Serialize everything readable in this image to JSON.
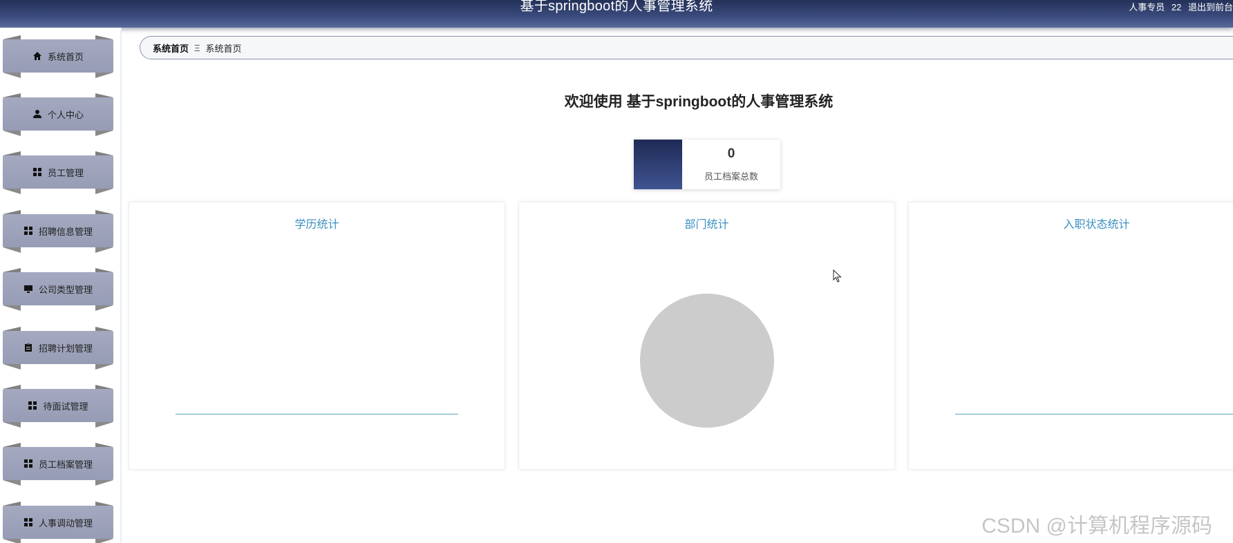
{
  "header": {
    "title": "基于springboot的人事管理系统",
    "user_role": "人事专员",
    "user_name": "22",
    "exit_label": "退出到前台"
  },
  "sidebar": {
    "items": [
      {
        "label": "系统首页",
        "icon": "home-icon"
      },
      {
        "label": "个人中心",
        "icon": "user-icon"
      },
      {
        "label": "员工管理",
        "icon": "grid-icon"
      },
      {
        "label": "招聘信息管理",
        "icon": "grid-icon"
      },
      {
        "label": "公司类型管理",
        "icon": "monitor-icon"
      },
      {
        "label": "招聘计划管理",
        "icon": "clipboard-icon"
      },
      {
        "label": "待面试管理",
        "icon": "grid-icon"
      },
      {
        "label": "员工档案管理",
        "icon": "grid-icon"
      },
      {
        "label": "人事调动管理",
        "icon": "grid-icon"
      }
    ]
  },
  "breadcrumb": {
    "home": "系统首页",
    "separator": "Ξ",
    "current": "系统首页"
  },
  "main": {
    "welcome": "欢迎使用 基于springboot的人事管理系统",
    "stat": {
      "value": "0",
      "label": "员工档案总数"
    },
    "panels": [
      {
        "title": "学历统计"
      },
      {
        "title": "部门统计"
      },
      {
        "title": "入职状态统计"
      }
    ]
  },
  "watermark": "CSDN @计算机程序源码",
  "colors": {
    "header_bg": "#2f3d6b",
    "menu_bg": "#9ea3bb",
    "panel_title": "#3a8fc0",
    "pie_empty": "#cccccc"
  }
}
